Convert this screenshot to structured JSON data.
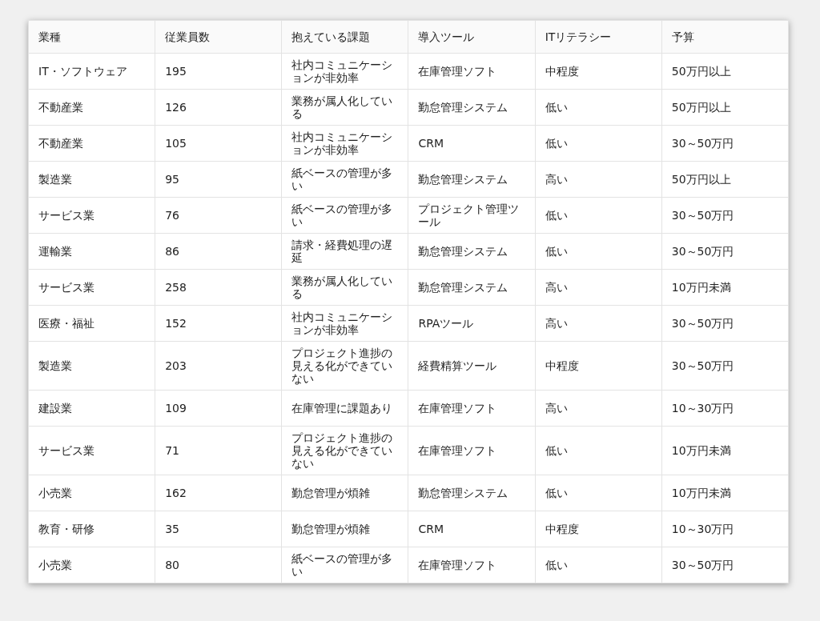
{
  "table": {
    "columns": [
      "業種",
      "従業員数",
      "抱えている課題",
      "導入ツール",
      "ITリテラシー",
      "予算"
    ],
    "rows": [
      [
        "IT・ソフトウェア",
        "195",
        "社内コミュニケーションが非効率",
        "在庫管理ソフト",
        "中程度",
        "50万円以上"
      ],
      [
        "不動産業",
        "126",
        "業務が属人化している",
        "勤怠管理システム",
        "低い",
        "50万円以上"
      ],
      [
        "不動産業",
        "105",
        "社内コミュニケーションが非効率",
        "CRM",
        "低い",
        "30～50万円"
      ],
      [
        "製造業",
        "95",
        "紙ベースの管理が多い",
        "勤怠管理システム",
        "高い",
        "50万円以上"
      ],
      [
        "サービス業",
        "76",
        "紙ベースの管理が多い",
        "プロジェクト管理ツール",
        "低い",
        "30～50万円"
      ],
      [
        "運輸業",
        "86",
        "請求・経費処理の遅延",
        "勤怠管理システム",
        "低い",
        "30～50万円"
      ],
      [
        "サービス業",
        "258",
        "業務が属人化している",
        "勤怠管理システム",
        "高い",
        "10万円未満"
      ],
      [
        "医療・福祉",
        "152",
        "社内コミュニケーションが非効率",
        "RPAツール",
        "高い",
        "30～50万円"
      ],
      [
        "製造業",
        "203",
        "プロジェクト進捗の見える化ができていない",
        "経費精算ツール",
        "中程度",
        "30～50万円"
      ],
      [
        "建設業",
        "109",
        "在庫管理に課題あり",
        "在庫管理ソフト",
        "高い",
        "10～30万円"
      ],
      [
        "サービス業",
        "71",
        "プロジェクト進捗の見える化ができていない",
        "在庫管理ソフト",
        "低い",
        "10万円未満"
      ],
      [
        "小売業",
        "162",
        "勤怠管理が煩雑",
        "勤怠管理システム",
        "低い",
        "10万円未満"
      ],
      [
        "教育・研修",
        "35",
        "勤怠管理が煩雑",
        "CRM",
        "中程度",
        "10～30万円"
      ],
      [
        "小売業",
        "80",
        "紙ベースの管理が多い",
        "在庫管理ソフト",
        "低い",
        "30～50万円"
      ]
    ]
  }
}
